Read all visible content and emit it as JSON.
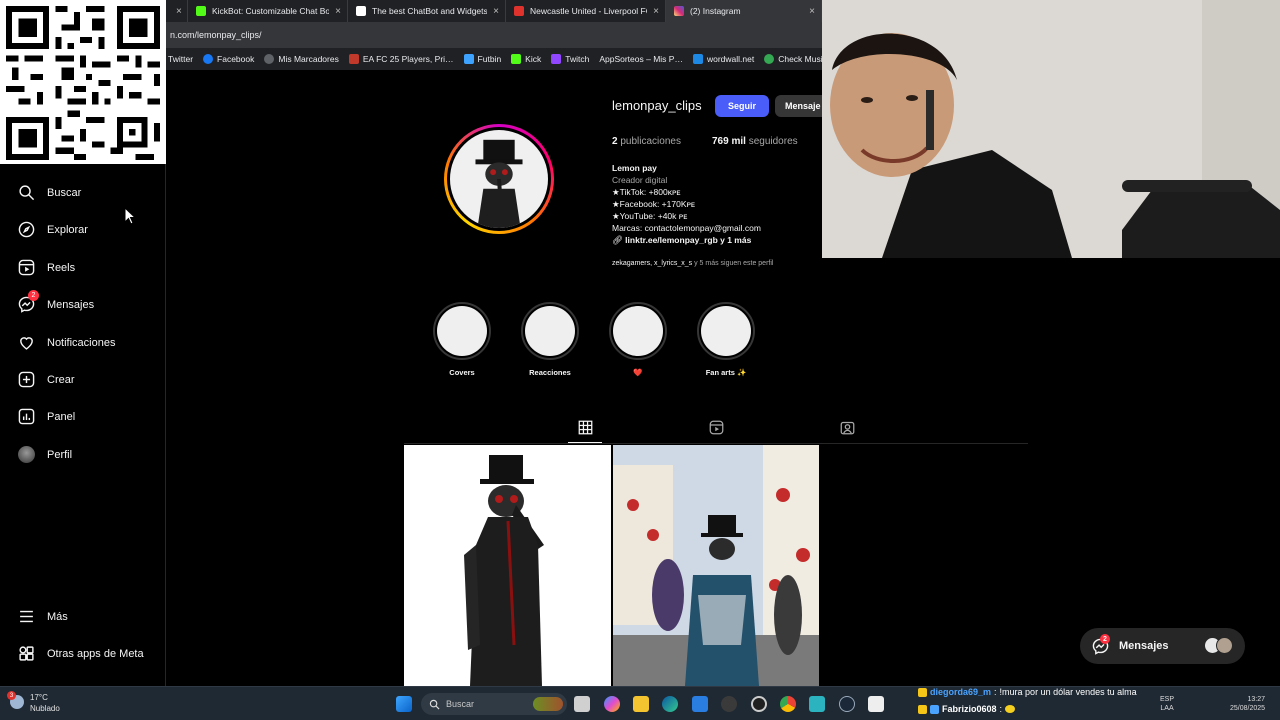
{
  "browser": {
    "tabs": [
      {
        "label": "",
        "close": "×",
        "color": "#5f6368"
      },
      {
        "label": "KickBot: Customizable Chat Bot f…",
        "close": "×",
        "color": "#53fc18"
      },
      {
        "label": "The best ChatBot and Widgets fo…",
        "close": "×",
        "color": "#ffffff"
      },
      {
        "label": "Newcastle United - Liverpool FC I…",
        "close": "×",
        "color": "#e0322d"
      },
      {
        "label": "(2) Instagram",
        "close": "×",
        "color": "#e1306c"
      }
    ],
    "url": "n.com/lemonpay_clips/",
    "bookmarks": [
      {
        "label": "Twitter",
        "color": "#202124"
      },
      {
        "label": "Facebook",
        "color": "#1877f2"
      },
      {
        "label": "Mis Marcadores",
        "color": "#3c4043"
      },
      {
        "label": "EA FC 25 Players, Pri…",
        "color": "#c0392b"
      },
      {
        "label": "Futbin",
        "color": "#3ea3ff"
      },
      {
        "label": "Kick",
        "color": "#53fc18"
      },
      {
        "label": "Twitch",
        "color": "#9146ff"
      },
      {
        "label": "AppSorteos – Mis P…",
        "color": "#f5a623"
      },
      {
        "label": "wordwall.net",
        "color": "#1e88e5"
      },
      {
        "label": "Check Music C…",
        "color": "#34a853"
      }
    ]
  },
  "sidebar": {
    "items": [
      {
        "label": "Buscar",
        "icon": "search-icon"
      },
      {
        "label": "Explorar",
        "icon": "compass-icon"
      },
      {
        "label": "Reels",
        "icon": "reels-icon"
      },
      {
        "label": "Mensajes",
        "icon": "messenger-icon",
        "badge": "2"
      },
      {
        "label": "Notificaciones",
        "icon": "heart-icon"
      },
      {
        "label": "Crear",
        "icon": "plus-square-icon"
      },
      {
        "label": "Panel",
        "icon": "dashboard-icon"
      },
      {
        "label": "Perfil",
        "icon": "avatar"
      },
      {
        "label": "Más",
        "icon": "menu-icon"
      },
      {
        "label": "Otras apps de Meta",
        "icon": "meta-apps-icon"
      }
    ]
  },
  "profile": {
    "username": "lemonpay_clips",
    "follow_label": "Seguir",
    "message_label": "Mensaje",
    "posts_count": "2",
    "posts_label": "publicaciones",
    "followers_count": "769 mil",
    "followers_label": "seguidores",
    "name": "Lemon pay",
    "category": "Creador digital",
    "bio": [
      "★TikTok: +800ᴋᴘᴇ",
      "★Facebook: +170Kᴘᴇ",
      "★YouTube: +40k ᴘᴇ",
      "Marcas: contactolemonpay@gmail.com"
    ],
    "link": "linktr.ee/lemonpay_rgb y 1 más",
    "followed_by_users": "zekagamers, x_lyrics_x_s",
    "followed_by_rest": " y 5 más siguen este perfil"
  },
  "highlights": [
    "Covers",
    "Reacciones",
    "❤️",
    "Fan arts ✨"
  ],
  "floating_messages": {
    "label": "Mensajes",
    "badge": "2"
  },
  "taskbar": {
    "temperature": "17°C",
    "weather": "Nublado",
    "weather_badge": "3",
    "search_placeholder": "Buscar",
    "lang_top": "ESP",
    "lang_bottom": "LAA",
    "time": "13:27",
    "date": "25/08/2025"
  },
  "chat": [
    {
      "user": "diegorda69_m",
      "message": "!mura por un dólar vendes tu alma"
    },
    {
      "user": "Fabrizio0608",
      "message": ""
    }
  ],
  "colors": {
    "accent": "#4a5df9",
    "badge": "#ff3040",
    "background": "#000000"
  }
}
